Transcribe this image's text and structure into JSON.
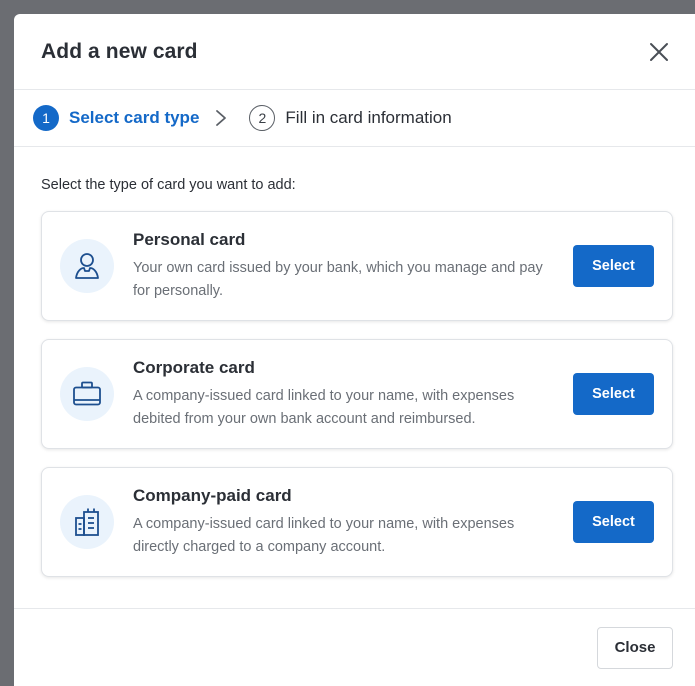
{
  "dialog": {
    "title": "Add a new card",
    "close_icon": "close-x-icon"
  },
  "stepper": {
    "steps": [
      {
        "number": "1",
        "label": "Select card type",
        "state": "active"
      },
      {
        "number": "2",
        "label": "Fill in card information",
        "state": "inactive"
      }
    ],
    "separator_icon": "chevron-right-icon"
  },
  "content": {
    "intro": "Select the type of card you want to add:",
    "cards": [
      {
        "icon": "person-icon",
        "title": "Personal card",
        "description": "Your own card issued by your bank, which you manage and pay for personally.",
        "button": "Select"
      },
      {
        "icon": "briefcase-icon",
        "title": "Corporate card",
        "description": "A company-issued card linked to your name, with expenses debited from your own bank account and reimbursed.",
        "button": "Select"
      },
      {
        "icon": "building-icon",
        "title": "Company-paid card",
        "description": "A company-issued card linked to your name, with expenses directly charged to a company account.",
        "button": "Select"
      }
    ]
  },
  "footer": {
    "close_label": "Close"
  },
  "colors": {
    "accent": "#1469c8",
    "icon_bg": "#eaf3fc",
    "overlay": "#6b6d72"
  }
}
